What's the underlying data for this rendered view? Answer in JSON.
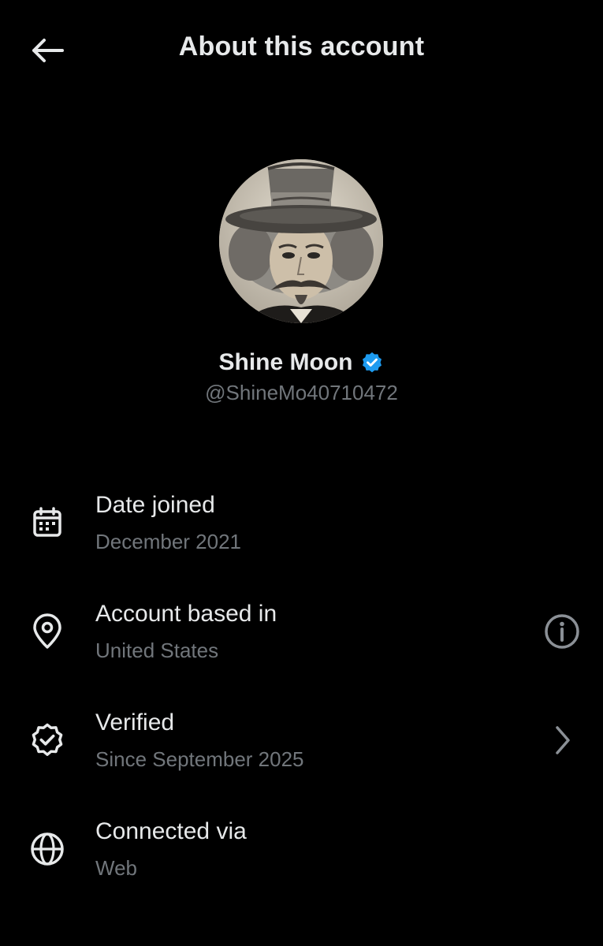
{
  "header": {
    "title": "About this account",
    "back_icon": "arrow-left-icon"
  },
  "profile": {
    "display_name": "Shine Moon",
    "handle": "@ShineMo40710472",
    "verified_badge_color": "#1d9bf0"
  },
  "rows": [
    {
      "icon": "calendar-icon",
      "title": "Date joined",
      "subtitle": "December 2021"
    },
    {
      "icon": "location-pin-icon",
      "title": "Account based in",
      "subtitle": "United States",
      "action_icon": "info-icon"
    },
    {
      "icon": "verified-seal-icon",
      "title": "Verified",
      "subtitle": "Since September 2025",
      "action_icon": "chevron-right-icon"
    },
    {
      "icon": "globe-icon",
      "title": "Connected via",
      "subtitle": "Web"
    }
  ],
  "colors": {
    "background": "#000000",
    "primary_text": "#e7e9ea",
    "secondary_text": "#71767b"
  }
}
